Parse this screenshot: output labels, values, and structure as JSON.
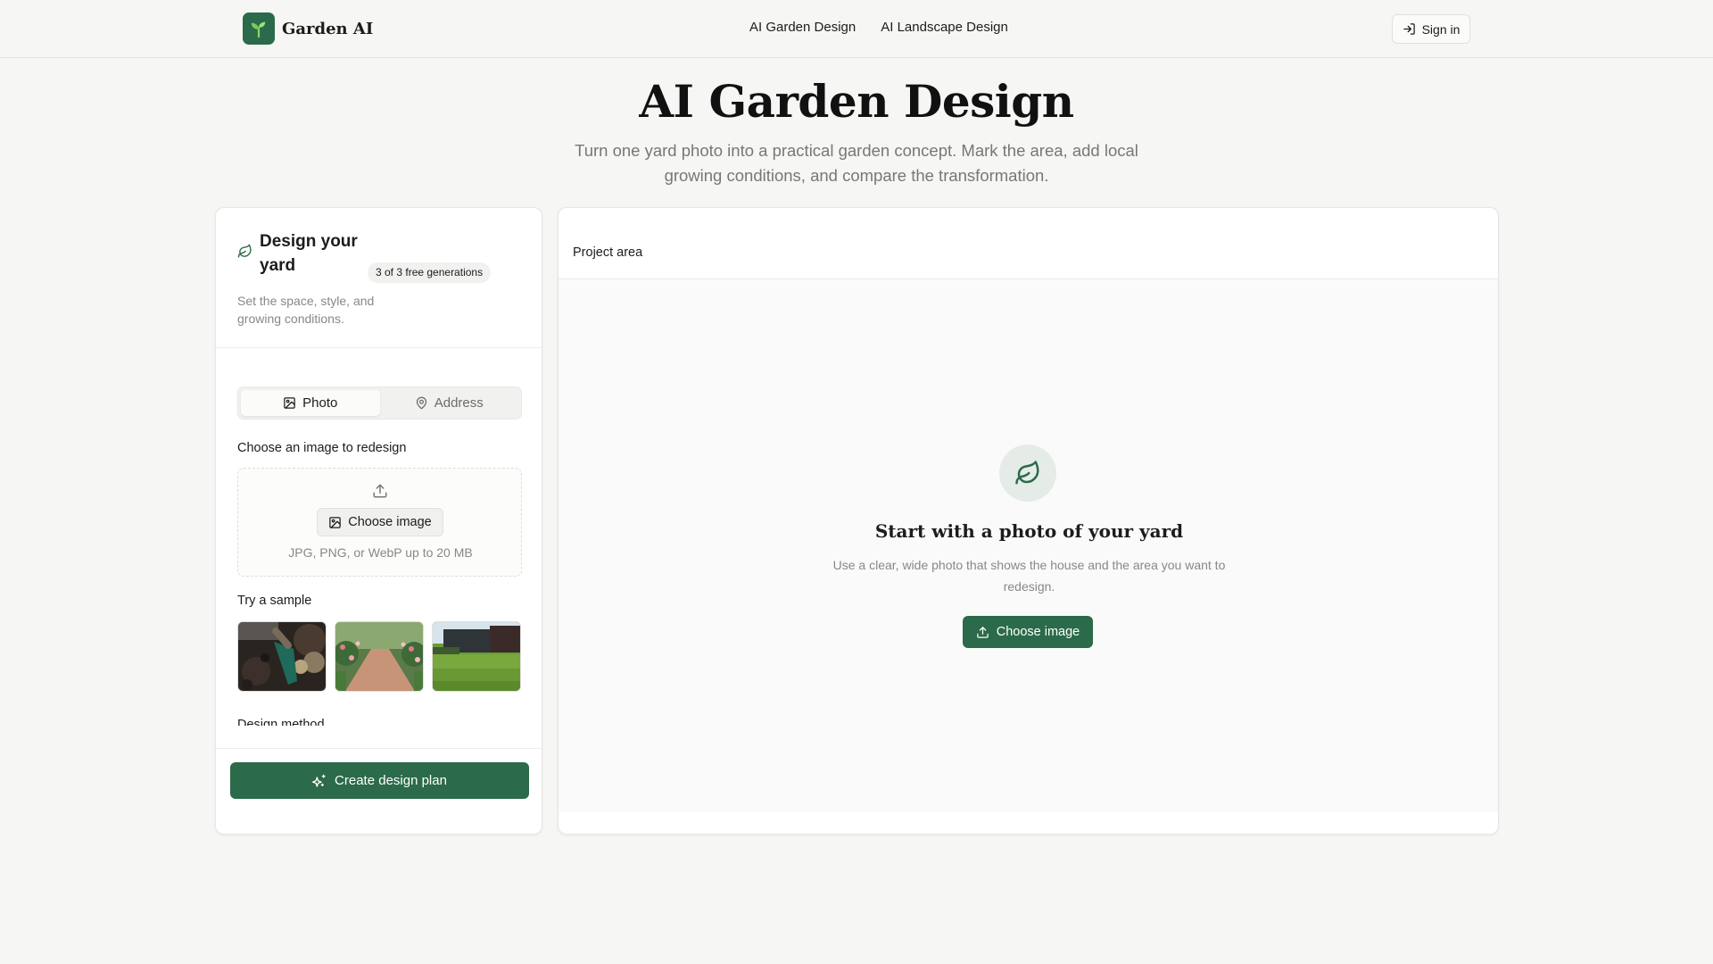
{
  "header": {
    "brand": "Garden AI",
    "nav": [
      "AI Garden Design",
      "AI Landscape Design"
    ],
    "sign_in": "Sign in"
  },
  "hero": {
    "title": "AI Garden Design",
    "subtitle": "Turn one yard photo into a practical garden concept. Mark the area, add local growing conditions, and compare the transformation."
  },
  "left_panel": {
    "title": "Design your yard",
    "subtitle": "Set the space, style, and growing conditions.",
    "badge": "3 of 3 free generations",
    "tabs": [
      "Photo",
      "Address"
    ],
    "choose_label": "Choose an image to redesign",
    "choose_button": "Choose image",
    "upload_hint": "JPG, PNG, or WebP up to 20 MB",
    "sample_label": "Try a sample",
    "method_label": "Design method",
    "create_button": "Create design plan"
  },
  "right_panel": {
    "label": "Project area",
    "empty_title": "Start with a photo of your yard",
    "empty_subtitle": "Use a clear, wide photo that shows the house and the area you want to redesign.",
    "empty_button": "Choose image"
  },
  "colors": {
    "accent": "#2b6a4a",
    "background": "#f6f6f4"
  }
}
